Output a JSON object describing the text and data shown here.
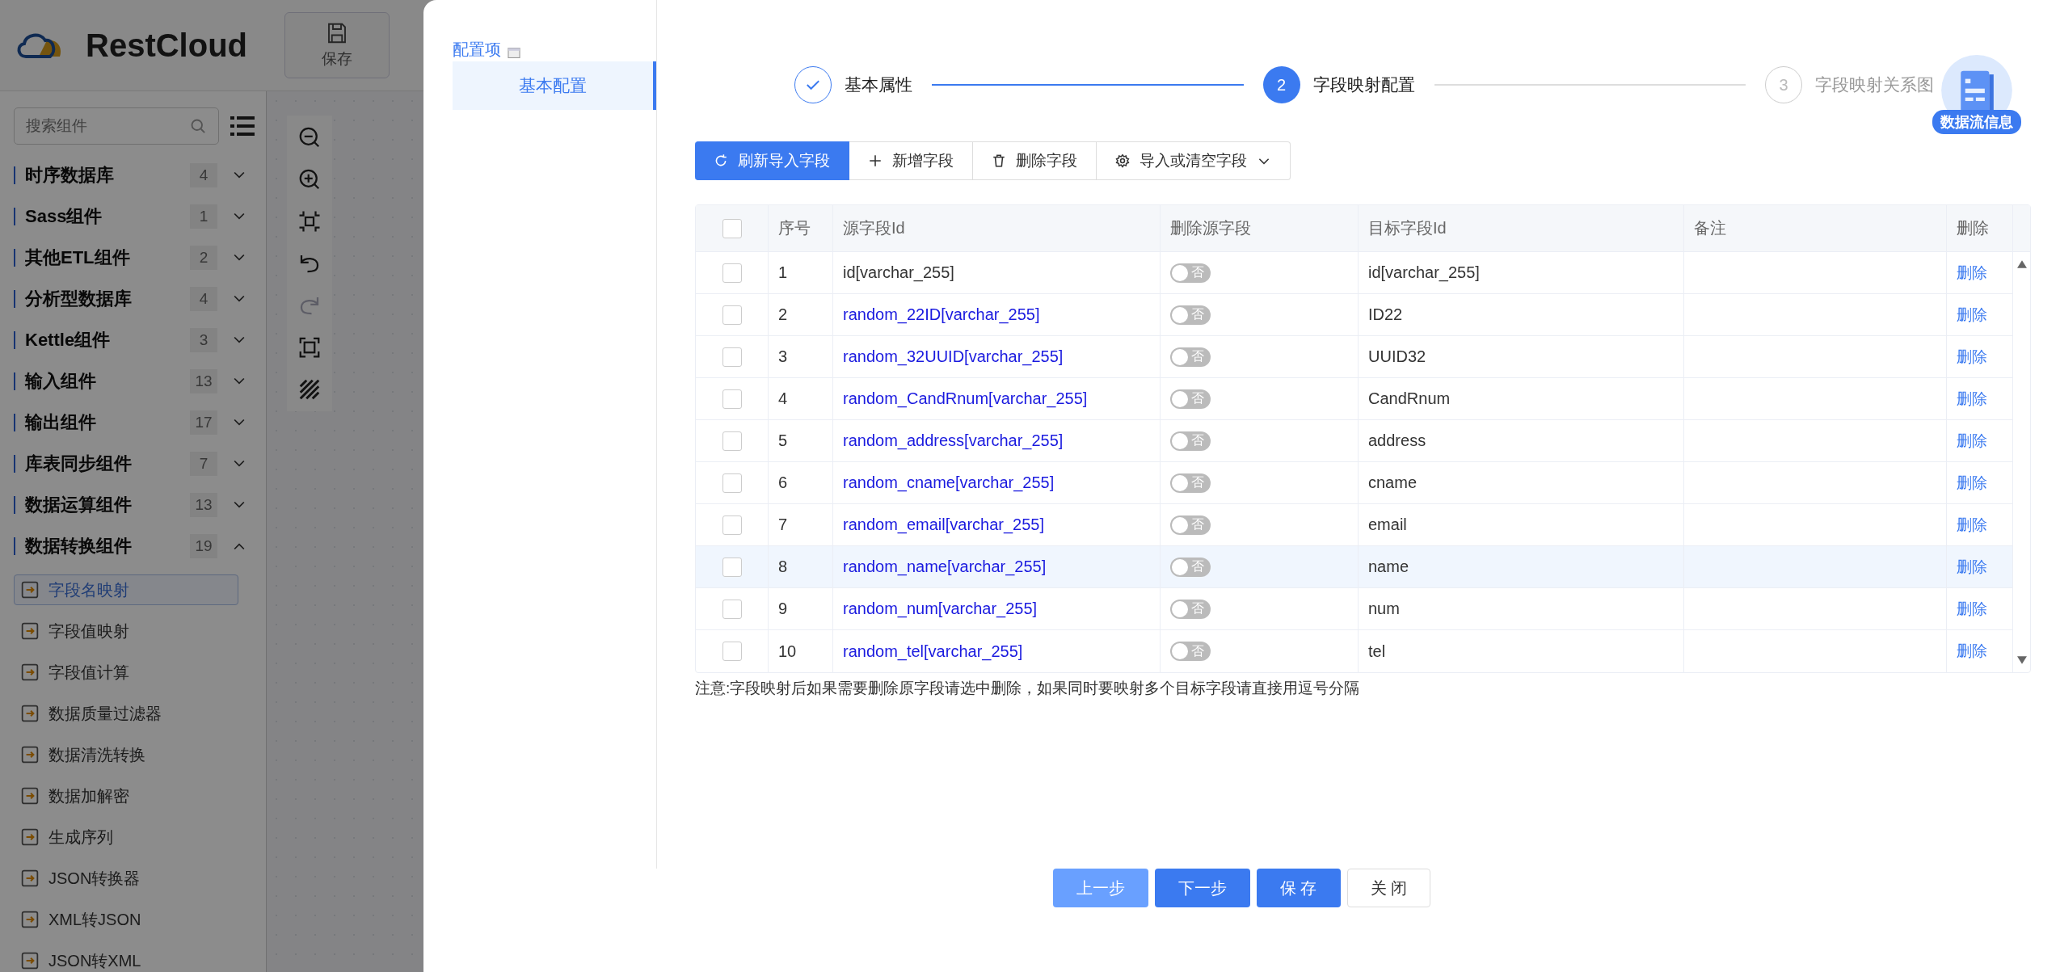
{
  "header": {
    "logo": "RestCloud",
    "save_button": "保存"
  },
  "sidebar": {
    "search": {
      "placeholder": "搜索组件"
    },
    "categories": [
      {
        "label": "时序数据库",
        "count": "4",
        "expanded": false
      },
      {
        "label": "Sass组件",
        "count": "1",
        "expanded": false
      },
      {
        "label": "其他ETL组件",
        "count": "2",
        "expanded": false
      },
      {
        "label": "分析型数据库",
        "count": "4",
        "expanded": false
      },
      {
        "label": "Kettle组件",
        "count": "3",
        "expanded": false
      },
      {
        "label": "输入组件",
        "count": "13",
        "expanded": false
      },
      {
        "label": "输出组件",
        "count": "17",
        "expanded": false
      },
      {
        "label": "库表同步组件",
        "count": "7",
        "expanded": false
      },
      {
        "label": "数据运算组件",
        "count": "13",
        "expanded": false
      },
      {
        "label": "数据转换组件",
        "count": "19",
        "expanded": true
      }
    ],
    "items": [
      {
        "label": "字段名映射",
        "selected": true
      },
      {
        "label": "字段值映射",
        "selected": false
      },
      {
        "label": "字段值计算",
        "selected": false
      },
      {
        "label": "数据质量过滤器",
        "selected": false
      },
      {
        "label": "数据清洗转换",
        "selected": false
      },
      {
        "label": "数据加解密",
        "selected": false
      },
      {
        "label": "生成序列",
        "selected": false
      },
      {
        "label": "JSON转换器",
        "selected": false
      },
      {
        "label": "XML转JSON",
        "selected": false
      },
      {
        "label": "JSON转XML",
        "selected": false
      }
    ]
  },
  "canvas_tools": [
    {
      "kind": "zoom-out",
      "disabled": false
    },
    {
      "kind": "zoom-in",
      "disabled": false
    },
    {
      "kind": "fit",
      "disabled": false
    },
    {
      "kind": "undo",
      "disabled": false
    },
    {
      "kind": "redo",
      "disabled": true
    },
    {
      "kind": "frame",
      "disabled": false
    },
    {
      "kind": "hatch",
      "disabled": false
    }
  ],
  "dialog": {
    "nav_title": "配置项",
    "nav_items": [
      {
        "label": "基本配置",
        "selected": true
      }
    ],
    "steps": [
      {
        "label": "基本属性",
        "completed": true,
        "selected": false
      },
      {
        "number": "2",
        "label": "字段映射配置",
        "completed": false,
        "selected": true
      },
      {
        "number": "3",
        "label": "字段映射关系图",
        "completed": false,
        "selected": false
      }
    ],
    "badge": "数据流信息",
    "toolbar": [
      {
        "kind": "refresh",
        "label": "刷新导入字段",
        "primary": true
      },
      {
        "kind": "add",
        "label": "新增字段",
        "primary": false
      },
      {
        "kind": "delete",
        "label": "删除字段",
        "primary": false
      },
      {
        "kind": "import",
        "label": "导入或清空字段",
        "primary": false
      }
    ],
    "table": {
      "all_checked": false,
      "columns": [
        "序号",
        "源字段Id",
        "删除源字段",
        "目标字段Id",
        "备注",
        "删除"
      ],
      "rows": [
        {
          "checked": false,
          "index": "1",
          "source": "id[varchar_255]",
          "linked": false,
          "delete_source": false,
          "switch_label": "否",
          "target": "id[varchar_255]",
          "action": "删除",
          "highlighted": false
        },
        {
          "checked": false,
          "index": "2",
          "source": "random_22ID[varchar_255]",
          "linked": true,
          "delete_source": false,
          "switch_label": "否",
          "target": "ID22",
          "action": "删除",
          "highlighted": false
        },
        {
          "checked": false,
          "index": "3",
          "source": "random_32UUID[varchar_255]",
          "linked": true,
          "delete_source": false,
          "switch_label": "否",
          "target": "UUID32",
          "action": "删除",
          "highlighted": false
        },
        {
          "checked": false,
          "index": "4",
          "source": "random_CandRnum[varchar_255]",
          "linked": true,
          "delete_source": false,
          "switch_label": "否",
          "target": "CandRnum",
          "action": "删除",
          "highlighted": false
        },
        {
          "checked": false,
          "index": "5",
          "source": "random_address[varchar_255]",
          "linked": true,
          "delete_source": false,
          "switch_label": "否",
          "target": "address",
          "action": "删除",
          "highlighted": false
        },
        {
          "checked": false,
          "index": "6",
          "source": "random_cname[varchar_255]",
          "linked": true,
          "delete_source": false,
          "switch_label": "否",
          "target": "cname",
          "action": "删除",
          "highlighted": false
        },
        {
          "checked": false,
          "index": "7",
          "source": "random_email[varchar_255]",
          "linked": true,
          "delete_source": false,
          "switch_label": "否",
          "target": "email",
          "action": "删除",
          "highlighted": false
        },
        {
          "checked": false,
          "index": "8",
          "source": "random_name[varchar_255]",
          "linked": true,
          "delete_source": false,
          "switch_label": "否",
          "target": "name",
          "action": "删除",
          "highlighted": true
        },
        {
          "checked": false,
          "index": "9",
          "source": "random_num[varchar_255]",
          "linked": true,
          "delete_source": false,
          "switch_label": "否",
          "target": "num",
          "action": "删除",
          "highlighted": false
        },
        {
          "checked": false,
          "index": "10",
          "source": "random_tel[varchar_255]",
          "linked": true,
          "delete_source": false,
          "switch_label": "否",
          "target": "tel",
          "action": "删除",
          "highlighted": false
        }
      ]
    },
    "note": "注意:字段映射后如果需要删除原字段请选中删除，如果同时要映射多个目标字段请直接用逗号分隔",
    "footer": [
      {
        "kind": "prev",
        "label": "上一步"
      },
      {
        "kind": "next",
        "label": "下一步"
      },
      {
        "kind": "save",
        "label": "保 存"
      },
      {
        "kind": "close",
        "label": "关 闭"
      }
    ]
  }
}
